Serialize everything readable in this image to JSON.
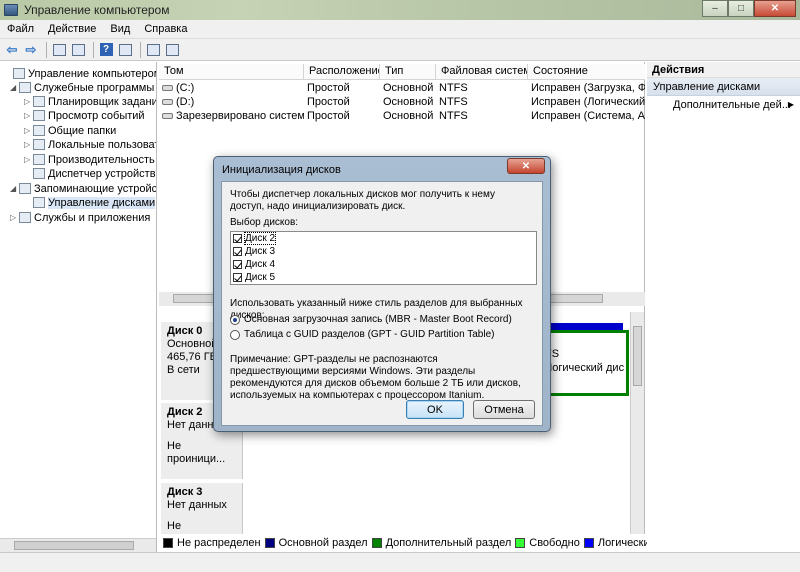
{
  "window": {
    "title": "Управление компьютером"
  },
  "menu": [
    "Файл",
    "Действие",
    "Вид",
    "Справка"
  ],
  "tree": {
    "items": [
      {
        "label": "Управление компьютером (л",
        "level": 0,
        "expander": ""
      },
      {
        "label": "Служебные программы",
        "level": 1,
        "expander": "◢"
      },
      {
        "label": "Планировщик заданий",
        "level": 2,
        "expander": "▷"
      },
      {
        "label": "Просмотр событий",
        "level": 2,
        "expander": "▷"
      },
      {
        "label": "Общие папки",
        "level": 2,
        "expander": "▷"
      },
      {
        "label": "Локальные пользовате",
        "level": 2,
        "expander": "▷"
      },
      {
        "label": "Производительность",
        "level": 2,
        "expander": "▷"
      },
      {
        "label": "Диспетчер устройств",
        "level": 2,
        "expander": ""
      },
      {
        "label": "Запоминающие устройст",
        "level": 1,
        "expander": "◢"
      },
      {
        "label": "Управление дисками",
        "level": 2,
        "expander": ""
      },
      {
        "label": "Службы и приложения",
        "level": 1,
        "expander": "▷"
      }
    ]
  },
  "volumes": {
    "headers": [
      "Том",
      "Расположение",
      "Тип",
      "Файловая система",
      "Состояние"
    ],
    "rows": [
      [
        "(C:)",
        "Простой",
        "Основной",
        "NTFS",
        "Исправен (Загрузка, Фай"
      ],
      [
        "(D:)",
        "Простой",
        "Основной",
        "NTFS",
        "Исправен (Логический д"
      ],
      [
        "Зарезервировано системой",
        "Простой",
        "Основной",
        "NTFS",
        "Исправен (Система, Акти"
      ]
    ]
  },
  "disks": {
    "disk0": {
      "name": "Диск 0",
      "type": "Основной",
      "size": "465,76 ГБ",
      "status": "В сети"
    },
    "disk2": {
      "name": "Диск 2",
      "type": "Нет данных",
      "status": "Не проиници..."
    },
    "disk3": {
      "name": "Диск 3",
      "type": "Нет данных",
      "status": "Не проиници..."
    },
    "behind_dialog": {
      "fs": "FS",
      "logical": "Логический дис"
    }
  },
  "legend": [
    {
      "label": "Не распределен",
      "color": "#000000"
    },
    {
      "label": "Основной раздел",
      "color": "#000080"
    },
    {
      "label": "Дополнительный раздел",
      "color": "#008000"
    },
    {
      "label": "Свободно",
      "color": "#33ff33"
    },
    {
      "label": "Логический диск",
      "color": "#0000ff"
    }
  ],
  "actions": {
    "header": "Действия",
    "section": "Управление дисками",
    "more": "Дополнительные дей..."
  },
  "dialog": {
    "title": "Инициализация дисков",
    "intro": "Чтобы диспетчер локальных дисков мог получить к нему доступ, надо инициализировать диск.",
    "select_label": "Выбор дисков:",
    "disks": [
      "Диск 2",
      "Диск 3",
      "Диск 4",
      "Диск 5"
    ],
    "style_label": "Использовать указанный ниже стиль разделов для выбранных дисков:",
    "option_mbr": "Основная загрузочная запись (MBR - Master Boot Record)",
    "option_gpt": "Таблица с GUID разделов (GPT - GUID Partition Table)",
    "selected_option": "mbr",
    "note": "Примечание: GPT-разделы не распознаются предшествующими версиями Windows. Эти разделы рекомендуются для дисков объемом больше 2 ТБ или дисков, используемых на компьютерах с процессором Itanium.",
    "ok_label": "OK",
    "cancel_label": "Отмена"
  }
}
